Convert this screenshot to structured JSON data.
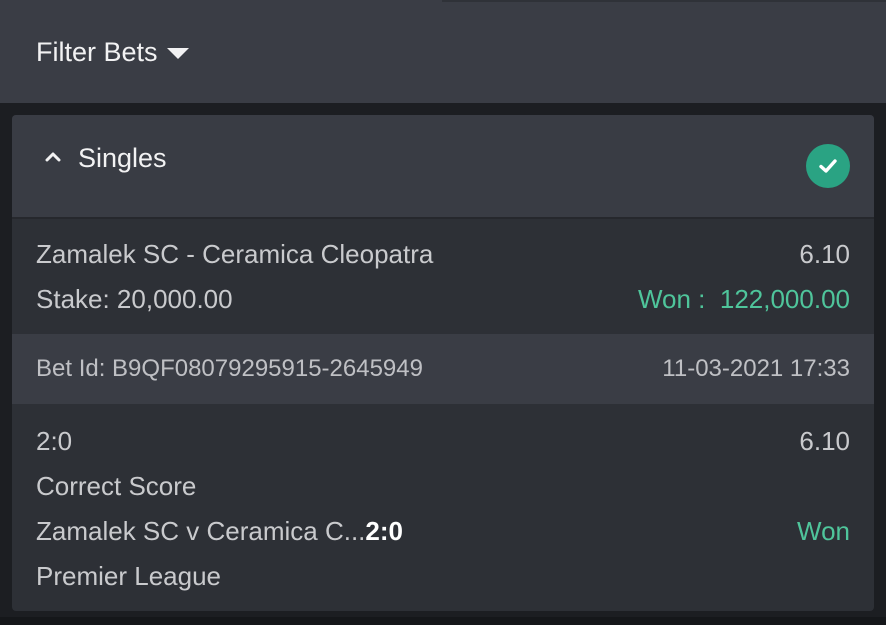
{
  "header": {
    "filter_label": "Filter Bets"
  },
  "section": {
    "title": "Singles"
  },
  "bet": {
    "match": "Zamalek SC - Ceramica Cleopatra",
    "odds": "6.10",
    "stake_label": "Stake: 20,000.00",
    "won_label": "Won :",
    "won_amount": "122,000.00",
    "bet_id": "Bet Id: B9QF08079295915-2645949",
    "datetime": "11-03-2021 17:33"
  },
  "selection": {
    "pick": "2:0",
    "odds": "6.10",
    "market": "Correct Score",
    "event": "Zamalek SC v Ceramica C...",
    "score": "2:0",
    "result": "Won",
    "league": "Premier League"
  },
  "colors": {
    "accent_green": "#4fc59b",
    "check_bg": "#2aa383"
  },
  "icons": {
    "filter": "caret-down-icon",
    "collapse": "chevron-up-icon",
    "status": "check-circle-icon"
  }
}
